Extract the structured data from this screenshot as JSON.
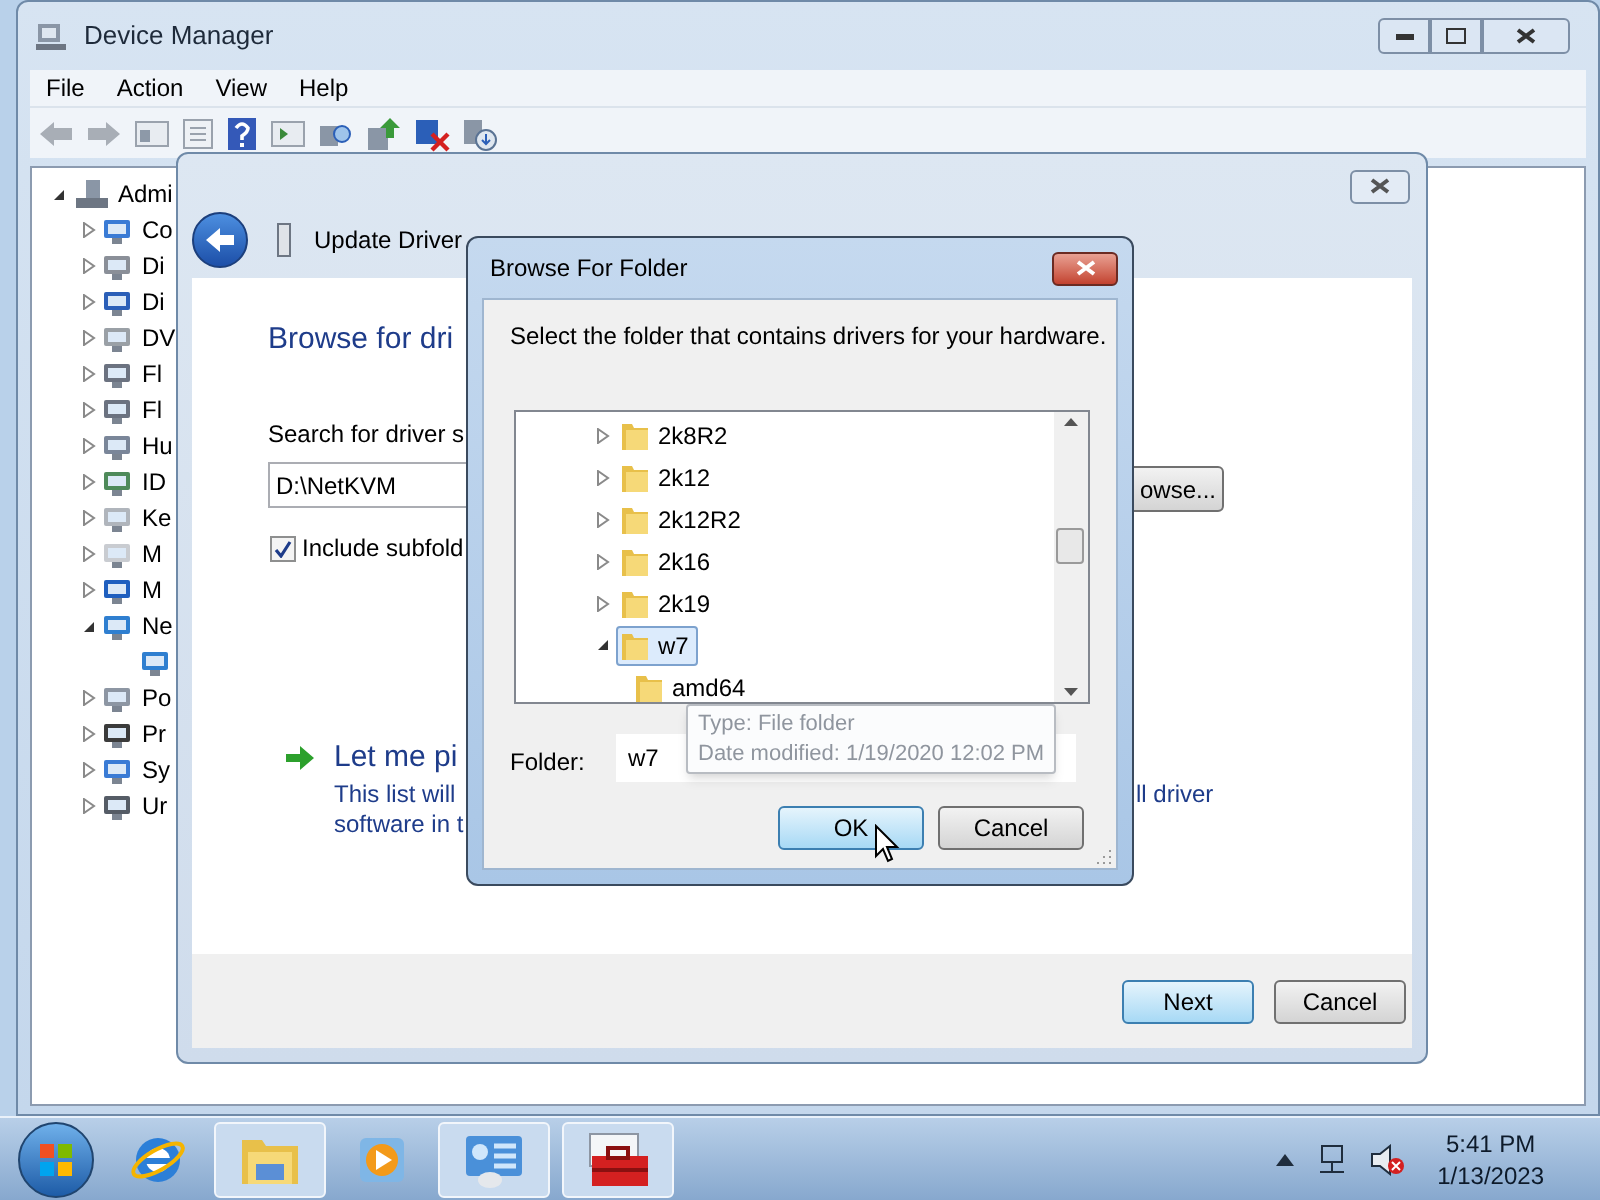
{
  "device_manager": {
    "title": "Device Manager",
    "menu": [
      "File",
      "Action",
      "View",
      "Help"
    ],
    "tree": {
      "label": "Admi",
      "expanded": true,
      "children": [
        {
          "label": "Co",
          "kind": "computer",
          "expanded": false
        },
        {
          "label": "Di",
          "kind": "disk",
          "expanded": false
        },
        {
          "label": "Di",
          "kind": "display",
          "expanded": false
        },
        {
          "label": "DV",
          "kind": "dvd",
          "expanded": false
        },
        {
          "label": "Fl",
          "kind": "floppy",
          "expanded": false
        },
        {
          "label": "Fl",
          "kind": "floppy",
          "expanded": false
        },
        {
          "label": "Hu",
          "kind": "hid",
          "expanded": false
        },
        {
          "label": "ID",
          "kind": "ide",
          "expanded": false
        },
        {
          "label": "Ke",
          "kind": "keyboard",
          "expanded": false
        },
        {
          "label": "M",
          "kind": "mouse",
          "expanded": false
        },
        {
          "label": "M",
          "kind": "monitor",
          "expanded": false
        },
        {
          "label": "Ne",
          "kind": "network",
          "expanded": true,
          "children": [
            {
              "kind": "network"
            }
          ]
        },
        {
          "label": "Po",
          "kind": "port",
          "expanded": false
        },
        {
          "label": "Pr",
          "kind": "processor",
          "expanded": false
        },
        {
          "label": "Sy",
          "kind": "computer",
          "expanded": false
        },
        {
          "label": "Ur",
          "kind": "usb",
          "expanded": false
        }
      ]
    }
  },
  "wizard": {
    "title": "Update Driver",
    "heading": "Browse for dri",
    "search_label": "Search for driver s",
    "path": "D:\\NetKVM",
    "browse_button": "owse...",
    "include_subfolders": {
      "label": "Include subfold",
      "checked": true
    },
    "option": {
      "title": "Let me pi",
      "line_1": "This list will",
      "line_1_end": "ll driver",
      "line_2": "software in t"
    },
    "buttons": [
      {
        "label": "Next",
        "default": true
      },
      {
        "label": "Cancel",
        "default": false
      }
    ]
  },
  "browse_dialog": {
    "title": "Browse For Folder",
    "prompt": "Select the folder that contains drivers for your hardware.",
    "tree": [
      {
        "label": "2k8R2",
        "expanded": false,
        "selected": false
      },
      {
        "label": "2k12",
        "expanded": false,
        "selected": false
      },
      {
        "label": "2k12R2",
        "expanded": false,
        "selected": false
      },
      {
        "label": "2k16",
        "expanded": false,
        "selected": false
      },
      {
        "label": "2k19",
        "expanded": false,
        "selected": false
      },
      {
        "label": "w7",
        "expanded": true,
        "selected": true,
        "children": [
          {
            "label": "amd64",
            "selected": false
          }
        ]
      }
    ],
    "folder_label": "Folder:",
    "folder_value": "w7",
    "tooltip": [
      "Type: File folder",
      "Date modified: 1/19/2020 12:02 PM"
    ],
    "buttons": [
      {
        "label": "OK",
        "default": true
      },
      {
        "label": "Cancel",
        "default": false
      }
    ]
  },
  "taskbar": {
    "items": [
      {
        "kind": "browser",
        "running": false
      },
      {
        "kind": "explorer",
        "running": true
      },
      {
        "kind": "media",
        "running": false
      },
      {
        "kind": "control",
        "running": true
      },
      {
        "kind": "toolbox",
        "running": true
      }
    ],
    "clock": {
      "time": "5:41 PM",
      "date": "1/13/2023"
    }
  }
}
